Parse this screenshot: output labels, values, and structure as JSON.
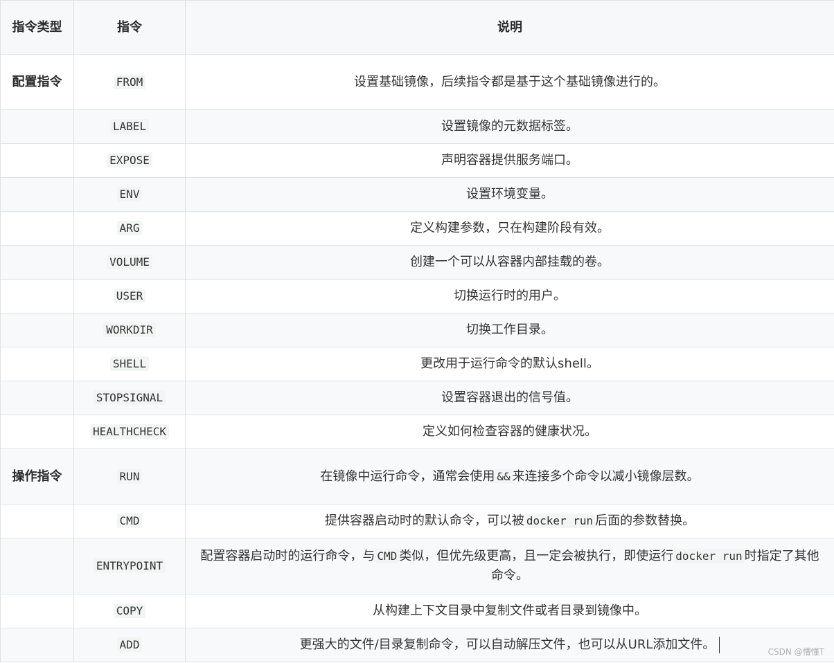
{
  "headers": {
    "type": "指令类型",
    "instruction": "指令",
    "description": "说明"
  },
  "rows": [
    {
      "type": "配置指令",
      "instruction": "FROM",
      "description": "设置基础镜像，后续指令都是基于这个基础镜像进行的。"
    },
    {
      "type": "",
      "instruction": "LABEL",
      "description": "设置镜像的元数据标签。"
    },
    {
      "type": "",
      "instruction": "EXPOSE",
      "description": "声明容器提供服务端口。"
    },
    {
      "type": "",
      "instruction": "ENV",
      "description": "设置环境变量。"
    },
    {
      "type": "",
      "instruction": "ARG",
      "description": "定义构建参数，只在构建阶段有效。"
    },
    {
      "type": "",
      "instruction": "VOLUME",
      "description": "创建一个可以从容器内部挂载的卷。"
    },
    {
      "type": "",
      "instruction": "USER",
      "description": "切换运行时的用户。"
    },
    {
      "type": "",
      "instruction": "WORKDIR",
      "description": "切换工作目录。"
    },
    {
      "type": "",
      "instruction": "SHELL",
      "description": "更改用于运行命令的默认shell。"
    },
    {
      "type": "",
      "instruction": "STOPSIGNAL",
      "description": "设置容器退出的信号值。"
    },
    {
      "type": "",
      "instruction": "HEALTHCHECK",
      "description": "定义如何检查容器的健康状况。"
    },
    {
      "type": "操作指令",
      "instruction": "RUN",
      "description_parts": [
        "在镜像中运行命令，通常会使用",
        "&&",
        "来连接多个命令以减小镜像层数。"
      ]
    },
    {
      "type": "",
      "instruction": "CMD",
      "description_parts": [
        "提供容器启动时的默认命令，可以被",
        "docker run",
        "后面的参数替换。"
      ]
    },
    {
      "type": "",
      "instruction": "ENTRYPOINT",
      "description_parts": [
        "配置容器启动时的运行命令，与",
        "CMD",
        "类似，但优先级更高，且一定会被执行，即使运行",
        "docker run",
        "时指定了其他命令。"
      ]
    },
    {
      "type": "",
      "instruction": "COPY",
      "description": "从构建上下文目录中复制文件或者目录到镜像中。"
    },
    {
      "type": "",
      "instruction": "ADD",
      "description": "更强大的文件/目录复制命令，可以自动解压文件，也可以从URL添加文件。"
    }
  ],
  "watermark": "CSDN @懵懂T"
}
